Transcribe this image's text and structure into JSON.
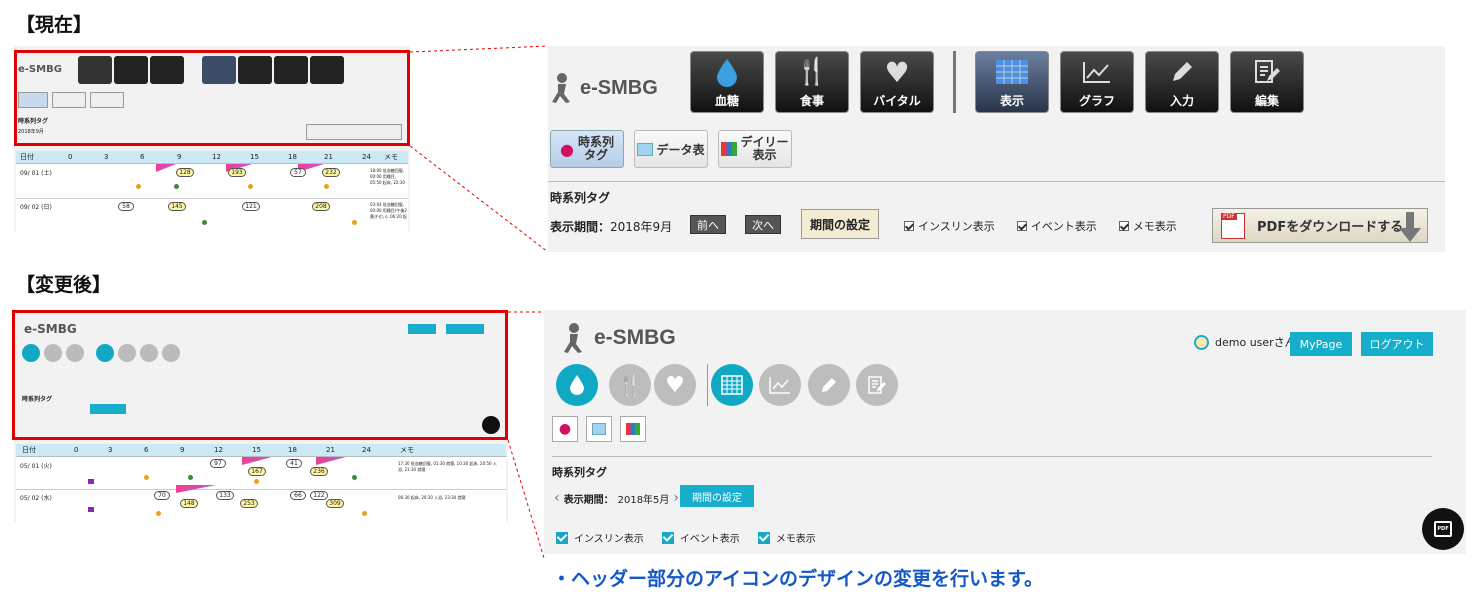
{
  "labels": {
    "before": "【現在】",
    "after": "【変更後】",
    "caption": "・ヘッダー部分のアイコンのデザインの変更を行います。"
  },
  "brand": "e-SMBG",
  "old": {
    "icons": [
      "血糖",
      "食事",
      "バイタル",
      "表示",
      "グラフ",
      "入力",
      "編集"
    ],
    "subtabs": [
      "時系列\nタグ",
      "データ表",
      "デイリー\n表示"
    ],
    "section": "時系列タグ",
    "period_label": "表示期間：",
    "period": "2018年9月",
    "prev": "前へ",
    "next": "次へ",
    "set_period": "期間の設定",
    "checks": [
      "インスリン表示",
      "イベント表示",
      "メモ表示"
    ],
    "pdf": "PDFをダウンロードする",
    "pdf_badge": "PDF"
  },
  "new": {
    "user": "demo userさん",
    "mypage": "MyPage",
    "logout": "ログアウト",
    "section": "時系列タグ",
    "period_label": "表示期間：",
    "period": "2018年5月",
    "set_period": "期間の設定",
    "checks": [
      "インスリン表示",
      "イベント表示",
      "メモ表示"
    ],
    "fab": "PDF"
  },
  "grid_old": {
    "head": [
      "日付",
      "0",
      "3",
      "6",
      "9",
      "12",
      "15",
      "18",
      "21",
      "24",
      "メモ"
    ],
    "rows": [
      {
        "date": "09/ 01 (土)",
        "memo": "18:00 低血糖回復, 00:00 用種目, 05:50 起床, 22:30 就寝",
        "bubbles": [
          "128",
          "193",
          "57",
          "232"
        ]
      },
      {
        "date": "09/ 02 (日)",
        "memo": "03:04 低血糖回復, 00:00 用種目(午後2番ぎせい), 06:20 起床, 23:00 就寝",
        "bubbles": [
          "58",
          "145",
          "121",
          "208"
        ]
      }
    ]
  },
  "grid_new": {
    "head": [
      "日付",
      "0",
      "3",
      "6",
      "9",
      "12",
      "15",
      "18",
      "21",
      "24",
      "メモ"
    ],
    "rows": [
      {
        "date": "05/ 01 (火)",
        "memo": "17:30 低血糖回復, 01:30 就寝, 10:30 起床, 20:50 入浴, 21:30 就寝",
        "bubbles": [
          "97",
          "167",
          "41",
          "236"
        ]
      },
      {
        "date": "05/ 02 (水)",
        "memo": "06:30 起床, 20:30 入浴, 23:30 就寝",
        "bubbles": [
          "70",
          "148",
          "133",
          "253",
          "66",
          "122",
          "309"
        ]
      }
    ]
  },
  "colors": {
    "red": "#e00000",
    "teal": "#16aecb",
    "caption": "#1458c8"
  }
}
